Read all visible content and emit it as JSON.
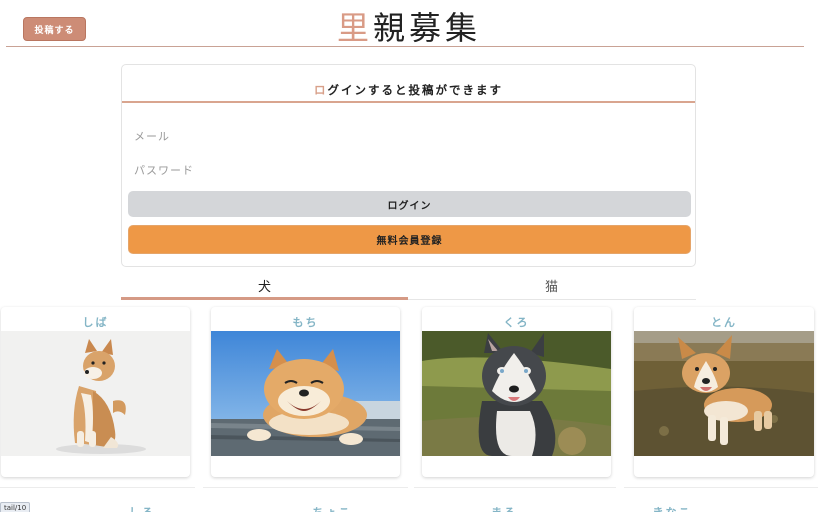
{
  "header": {
    "post_button": "投稿する",
    "title_accent": "里",
    "title_rest": "親募集"
  },
  "login": {
    "title_first": "ロ",
    "title_rest": "グインすると投稿ができます",
    "email_placeholder": "メール",
    "password_placeholder": "パスワード",
    "login_button": "ログイン",
    "register_button": "無料会員登録"
  },
  "tabs": [
    {
      "label": "犬",
      "active": true
    },
    {
      "label": "猫",
      "active": false
    }
  ],
  "pets": [
    {
      "name": "しば",
      "photo": "shiba-sitting-photo"
    },
    {
      "name": "もち",
      "photo": "smiling-shiba-photo"
    },
    {
      "name": "くろ",
      "photo": "husky-photo"
    },
    {
      "name": "とん",
      "photo": "corgi-photo"
    }
  ],
  "pets_row2": [
    "しろ",
    "ちょこ",
    "まる",
    "きなこ"
  ],
  "status_tip": "tail/10",
  "colors": {
    "accent": "#cd8c76",
    "register": "#ee9846",
    "pet_name": "#84b5c6"
  }
}
